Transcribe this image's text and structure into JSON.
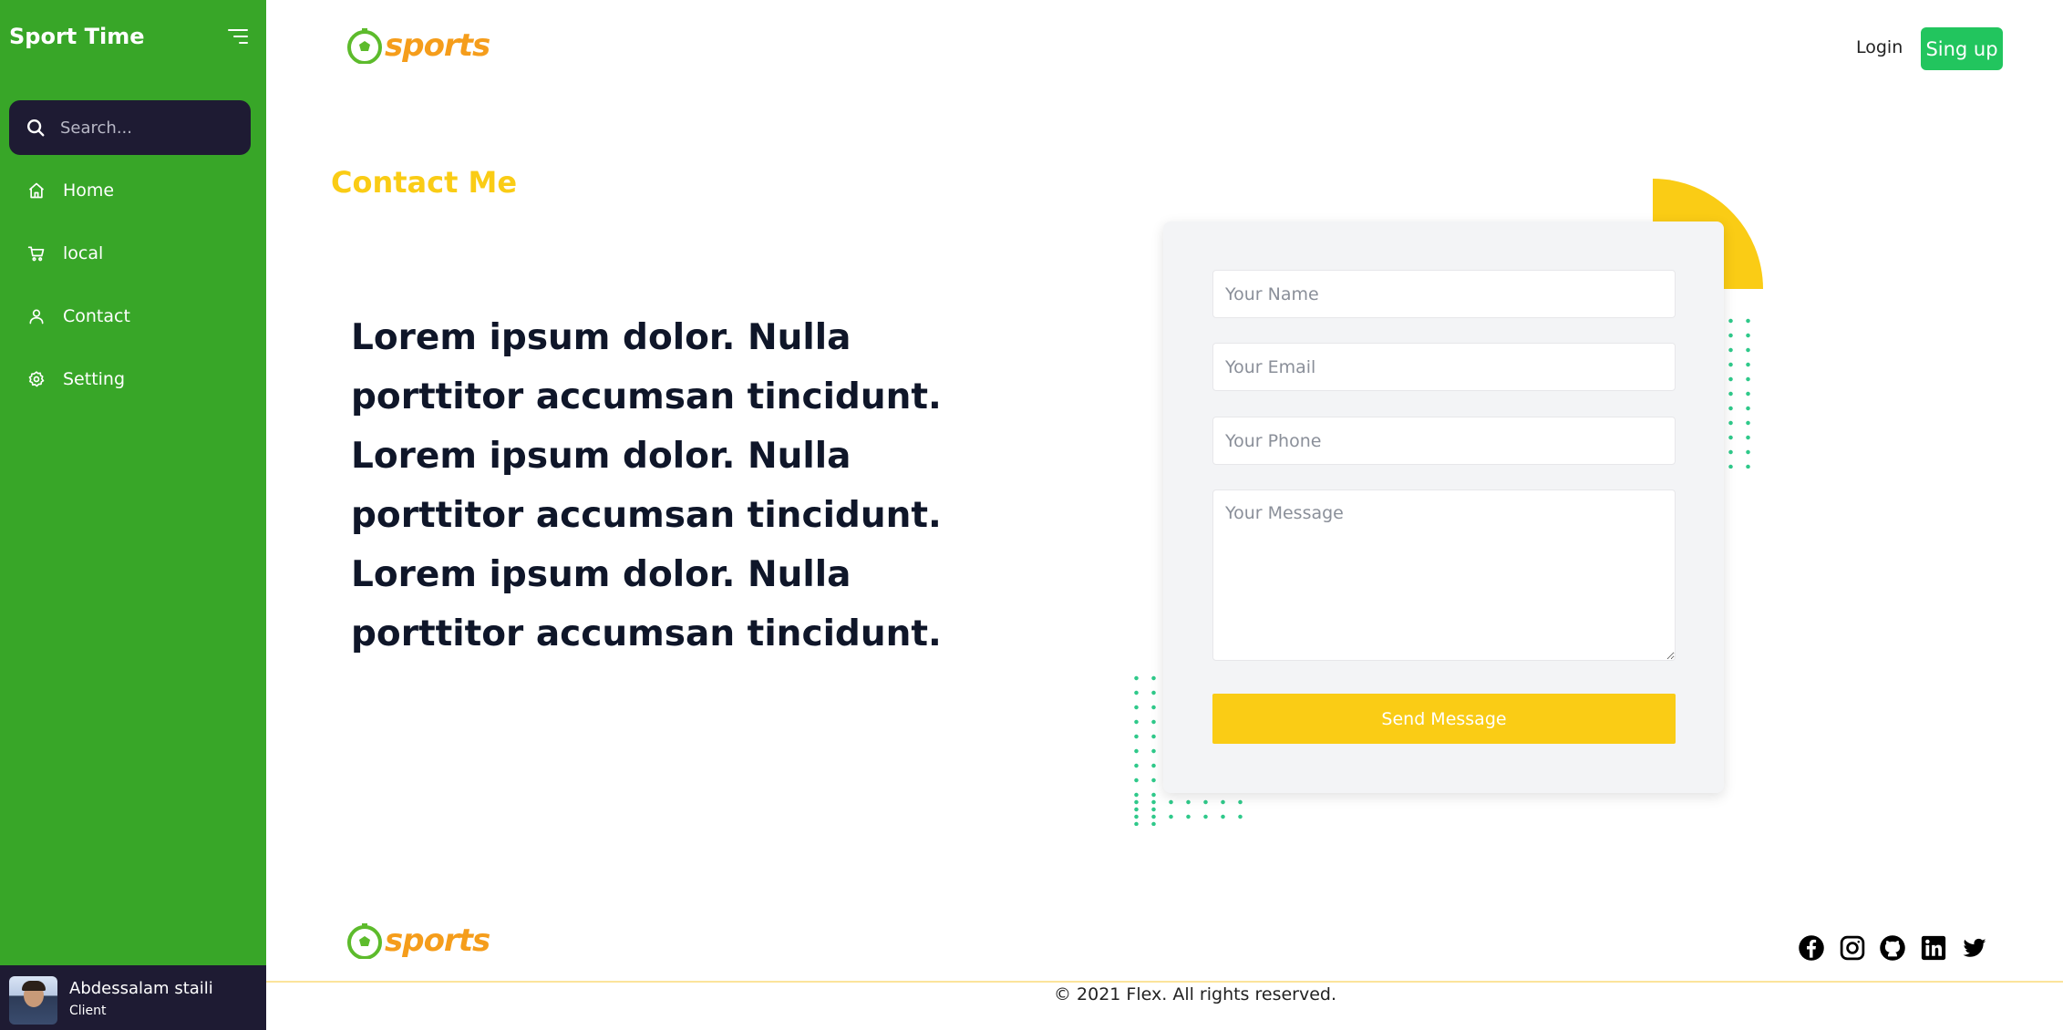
{
  "sidebar": {
    "brand": "Sport Time",
    "search_placeholder": "Search...",
    "items": [
      {
        "label": "Home",
        "icon": "home-icon"
      },
      {
        "label": "local",
        "icon": "cart-icon"
      },
      {
        "label": "Contact",
        "icon": "user-icon"
      },
      {
        "label": "Setting",
        "icon": "gear-icon"
      }
    ],
    "user": {
      "name": "Abdessalam staili",
      "role": "Client"
    }
  },
  "header": {
    "logo_text": "sports",
    "login_label": "Login",
    "signup_label": "Sing up"
  },
  "main": {
    "title": "Contact Me",
    "paragraph": "Lorem ipsum dolor. Nulla porttitor accumsan tincidunt. Lorem ipsum dolor. Nulla porttitor accumsan tincidunt. Lorem ipsum dolor. Nulla porttitor accumsan tincidunt."
  },
  "form": {
    "name_placeholder": "Your Name",
    "email_placeholder": "Your Email",
    "phone_placeholder": "Your Phone",
    "message_placeholder": "Your Message",
    "submit_label": "Send Message"
  },
  "footer": {
    "logo_text": "sports",
    "copyright": "© 2021 Flex. All rights reserved.",
    "social": [
      "facebook-icon",
      "instagram-icon",
      "github-icon",
      "linkedin-icon",
      "twitter-icon"
    ]
  },
  "colors": {
    "sidebar_green": "#38a628",
    "dark_navy": "#1e1b33",
    "accent_yellow": "#facc15",
    "signup_green": "#22c55e",
    "logo_orange": "#f59d1b",
    "dot_teal": "#2fc98a"
  }
}
